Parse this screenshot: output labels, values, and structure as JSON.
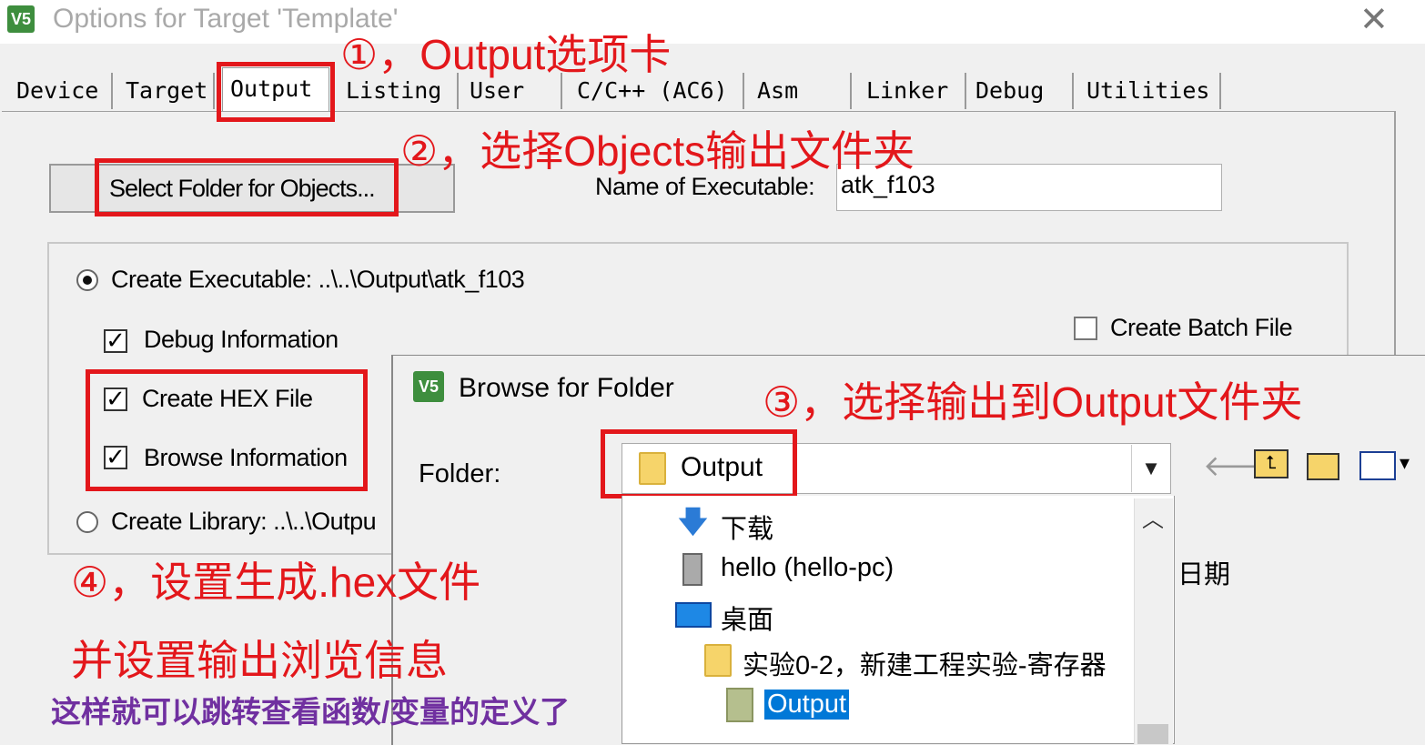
{
  "window": {
    "title": "Options for Target 'Template'",
    "close": "✕",
    "app_icon_text": "V5"
  },
  "tabs": [
    {
      "label": "Device",
      "active": false
    },
    {
      "label": "Target",
      "active": false
    },
    {
      "label": "Output",
      "active": true
    },
    {
      "label": "Listing",
      "active": false
    },
    {
      "label": "User",
      "active": false
    },
    {
      "label": "C/C++ (AC6)",
      "active": false
    },
    {
      "label": "Asm",
      "active": false
    },
    {
      "label": "Linker",
      "active": false
    },
    {
      "label": "Debug",
      "active": false
    },
    {
      "label": "Utilities",
      "active": false
    }
  ],
  "output": {
    "select_folder_button": "Select Folder for Objects...",
    "name_of_executable_label": "Name of Executable:",
    "name_of_executable_value": "atk_f103",
    "create_executable_label": "Create Executable:  ..\\..\\Output\\atk_f103",
    "debug_information": "Debug Information",
    "create_hex_file": "Create HEX File",
    "browse_information": "Browse Information",
    "create_library_label": "Create Library:  ..\\..\\Outpu",
    "create_batch_file": "Create Batch File"
  },
  "browse_dialog": {
    "title": "Browse for Folder",
    "app_icon_text": "V5",
    "folder_label": "Folder:",
    "folder_value": "Output",
    "toolbar_icons": [
      "back-arrow-icon",
      "up-folder-icon",
      "new-folder-icon",
      "view-menu-icon"
    ],
    "tree": [
      {
        "label": "下载",
        "icon": "download-arrow-icon"
      },
      {
        "label": "hello (hello-pc)",
        "icon": "network-pc-icon"
      },
      {
        "label": "桌面",
        "icon": "desktop-icon"
      },
      {
        "label": "实验0-2，新建工程实验-寄存器",
        "icon": "folder-icon"
      },
      {
        "label": "Output",
        "icon": "folder-icon",
        "selected": true
      }
    ],
    "date_column": "日期"
  },
  "annotations": {
    "step1": "①，Output选项卡",
    "step2": "②，选择Objects输出文件夹",
    "step3": "③，选择输出到Output文件夹",
    "step4_line1": "④，设置生成.hex文件",
    "step4_line2": "并设置输出浏览信息",
    "footer": "这样就可以跳转查看函数/变量的定义了"
  },
  "colors": {
    "annotation_red": "#e3171b",
    "footer_purple": "#7030a0",
    "selection_blue": "#0078d7"
  }
}
